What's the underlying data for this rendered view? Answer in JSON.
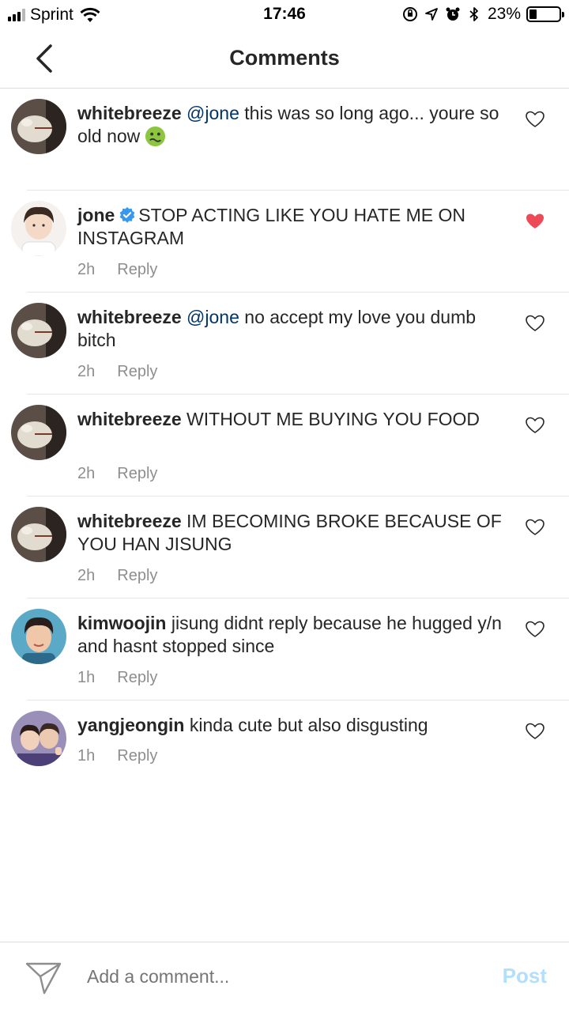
{
  "status_bar": {
    "carrier": "Sprint",
    "time": "17:46",
    "battery": "23%"
  },
  "header": {
    "title": "Comments",
    "back_icon": "chevron-left-icon"
  },
  "comments": [
    {
      "username": "whitebreeze",
      "mention": "@jone",
      "text": " this was so long ago... youre so old now",
      "emoji": "nauseated-face",
      "liked": false
    },
    {
      "username": "jone",
      "verified": true,
      "text": "STOP ACTING LIKE YOU HATE ME ON INSTAGRAM",
      "time": "2h",
      "reply": "Reply",
      "liked": true
    },
    {
      "username": "whitebreeze",
      "mention": "@jone",
      "text": " no accept my love you dumb bitch",
      "time": "2h",
      "reply": "Reply",
      "liked": false
    },
    {
      "username": "whitebreeze",
      "text": " WITHOUT ME BUYING YOU FOOD",
      "time": "2h",
      "reply": "Reply",
      "liked": false
    },
    {
      "username": "whitebreeze",
      "text": " IM BECOMING BROKE BECAUSE OF YOU HAN JISUNG",
      "time": "2h",
      "reply": "Reply",
      "liked": false
    },
    {
      "username": "kimwoojin",
      "text": " jisung didnt reply because he hugged y/n and hasnt stopped since",
      "time": "1h",
      "reply": "Reply",
      "liked": false
    },
    {
      "username": "yangjeongin",
      "text": " kinda cute but also disgusting",
      "time": "1h",
      "reply": "Reply",
      "liked": false
    }
  ],
  "composer": {
    "placeholder": "Add a comment...",
    "post_label": "Post"
  },
  "colors": {
    "liked_heart": "#ed4956",
    "mention": "#003569",
    "post_disabled": "#b2dffc",
    "verified": "#3897f0"
  }
}
